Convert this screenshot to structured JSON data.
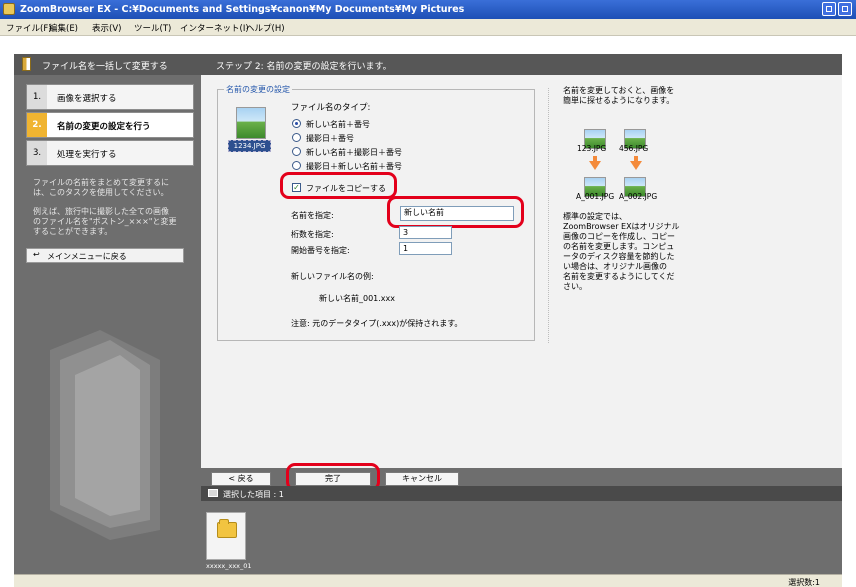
{
  "window": {
    "title": "ZoomBrowser EX  -  C:¥Documents and Settings¥canon¥My Documents¥My Pictures"
  },
  "menu": [
    "ファイル(F)",
    "編集(E)",
    "表示(V)",
    "ツール(T)",
    "インターネット(I)",
    "ヘルプ(H)"
  ],
  "sidebar": {
    "header": "ファイル名を一括して変更する",
    "steps": [
      {
        "num": "1.",
        "label": "画像を選択する"
      },
      {
        "num": "2.",
        "label": "名前の変更の設定を行う"
      },
      {
        "num": "3.",
        "label": "処理を実行する"
      }
    ],
    "desc1_l1": "ファイルの名前をまとめて変更するに",
    "desc1_l2": "は、このタスクを使用してください。",
    "desc2_l1": "例えば、旅行中に撮影した全ての画像",
    "desc2_l2": "のファイル名を\"ボストン_×××\"と変更",
    "desc2_l3": "することができます。",
    "back_to_menu": "メインメニューに戻る"
  },
  "main": {
    "header": "ステップ 2: 名前の変更の設定を行います。",
    "group_title": "名前の変更の設定",
    "thumb_filename": "1234.JPG",
    "file_type_label": "ファイル名のタイプ:",
    "radio_options": [
      "新しい名前＋番号",
      "撮影日＋番号",
      "新しい名前＋撮影日＋番号",
      "撮影日＋新しい名前＋番号"
    ],
    "copy_checkbox": "ファイルをコピーする",
    "name_label": "名前を指定:",
    "name_value": "新しい名前",
    "digits_label": "桁数を指定:",
    "digits_value": "3",
    "start_label": "開始番号を指定:",
    "start_value": "1",
    "example_label": "新しいファイル名の例:",
    "example_value": "新しい名前_001.xxx",
    "note": "注意: 元のデータタイプ(.xxx)が保持されます。",
    "right_top_l1": "名前を変更しておくと、画像を",
    "right_top_l2": "簡単に探せるようになります。",
    "before_files": [
      "123.JPG",
      "456.JPG"
    ],
    "after_files": [
      "A_001.JPG",
      "A_002.JPG"
    ],
    "right_desc": [
      "標準の設定では、",
      "ZoomBrowser EXはオリジナル",
      "画像のコピーを作成し、コピー",
      "の名前を変更します。コンピュ",
      "ータのディスク容量を節約した",
      "い場合は、オリジナル画像の",
      "名前を変更するようにしてくだ",
      "さい。"
    ]
  },
  "buttons": {
    "back": "< 戻る",
    "done": "完了",
    "cancel": "キャンセル"
  },
  "selected": {
    "label": "選択した項目 : 1",
    "item_name": "xxxxx_xxx_01"
  },
  "status": {
    "count": "選択数:1"
  },
  "colors": {
    "highlight_ring": "#e3001b",
    "active_step": "#f0b431"
  }
}
